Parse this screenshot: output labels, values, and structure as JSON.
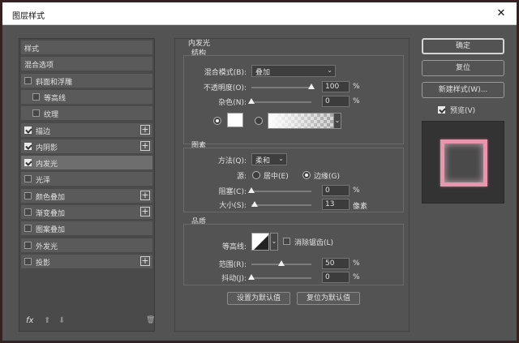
{
  "window": {
    "title": "图层样式",
    "close_icon": "close-icon"
  },
  "sidebar": {
    "items": [
      {
        "label": "样式",
        "has_checkbox": false,
        "checked": false,
        "has_plus": false,
        "selected": false,
        "indent": 0
      },
      {
        "label": "混合选项",
        "has_checkbox": false,
        "checked": false,
        "has_plus": false,
        "selected": false,
        "indent": 0
      },
      {
        "label": "斜面和浮雕",
        "has_checkbox": true,
        "checked": false,
        "has_plus": false,
        "selected": false,
        "indent": 0
      },
      {
        "label": "等高线",
        "has_checkbox": true,
        "checked": false,
        "has_plus": false,
        "selected": false,
        "indent": 1
      },
      {
        "label": "纹理",
        "has_checkbox": true,
        "checked": false,
        "has_plus": false,
        "selected": false,
        "indent": 1
      },
      {
        "label": "描边",
        "has_checkbox": true,
        "checked": true,
        "has_plus": true,
        "selected": false,
        "indent": 0
      },
      {
        "label": "内阴影",
        "has_checkbox": true,
        "checked": true,
        "has_plus": true,
        "selected": false,
        "indent": 0
      },
      {
        "label": "内发光",
        "has_checkbox": true,
        "checked": true,
        "has_plus": false,
        "selected": true,
        "indent": 0
      },
      {
        "label": "光泽",
        "has_checkbox": true,
        "checked": false,
        "has_plus": false,
        "selected": false,
        "indent": 0
      },
      {
        "label": "颜色叠加",
        "has_checkbox": true,
        "checked": false,
        "has_plus": true,
        "selected": false,
        "indent": 0
      },
      {
        "label": "渐变叠加",
        "has_checkbox": true,
        "checked": false,
        "has_plus": true,
        "selected": false,
        "indent": 0
      },
      {
        "label": "图案叠加",
        "has_checkbox": true,
        "checked": false,
        "has_plus": false,
        "selected": false,
        "indent": 0
      },
      {
        "label": "外发光",
        "has_checkbox": true,
        "checked": false,
        "has_plus": false,
        "selected": false,
        "indent": 0
      },
      {
        "label": "投影",
        "has_checkbox": true,
        "checked": false,
        "has_plus": true,
        "selected": false,
        "indent": 0
      }
    ],
    "footer": {
      "fx": "fx",
      "up": "⬆",
      "down": "⬇",
      "trash": "🗑"
    }
  },
  "inner_glow": {
    "title": "内发光",
    "structure": {
      "title": "结构",
      "blend_mode_label": "混合模式(B):",
      "blend_mode_value": "叠加",
      "opacity_label": "不透明度(O):",
      "opacity_value": "100",
      "opacity_level": 1.0,
      "noise_label": "杂色(N):",
      "noise_value": "0",
      "noise_level": 0.0,
      "percent": "%"
    },
    "elements": {
      "title": "图素",
      "method_label": "方法(Q):",
      "method_value": "柔和",
      "source_label": "源:",
      "source_center": "居中(E)",
      "source_edge": "边缘(G)",
      "choke_label": "阻塞(C):",
      "choke_value": "0",
      "choke_level": 0.0,
      "size_label": "大小(S):",
      "size_value": "13",
      "size_level": 0.05,
      "pixels": "像素",
      "percent": "%"
    },
    "quality": {
      "title": "品质",
      "contour_label": "等高线:",
      "antialias_label": "消除锯齿(L)",
      "range_label": "范围(R):",
      "range_value": "50",
      "range_level": 0.5,
      "jitter_label": "抖动(J):",
      "jitter_value": "0",
      "jitter_level": 0.0,
      "percent": "%"
    },
    "set_default": "设置为默认值",
    "reset_default": "复位为默认值"
  },
  "actions": {
    "ok": "确定",
    "reset": "复位",
    "new_style": "新建样式(W)...",
    "preview_label": "预览(V)",
    "preview_checked": true
  },
  "colors": {
    "glow": "#ffffff",
    "preview_stroke": "#e896ae"
  }
}
